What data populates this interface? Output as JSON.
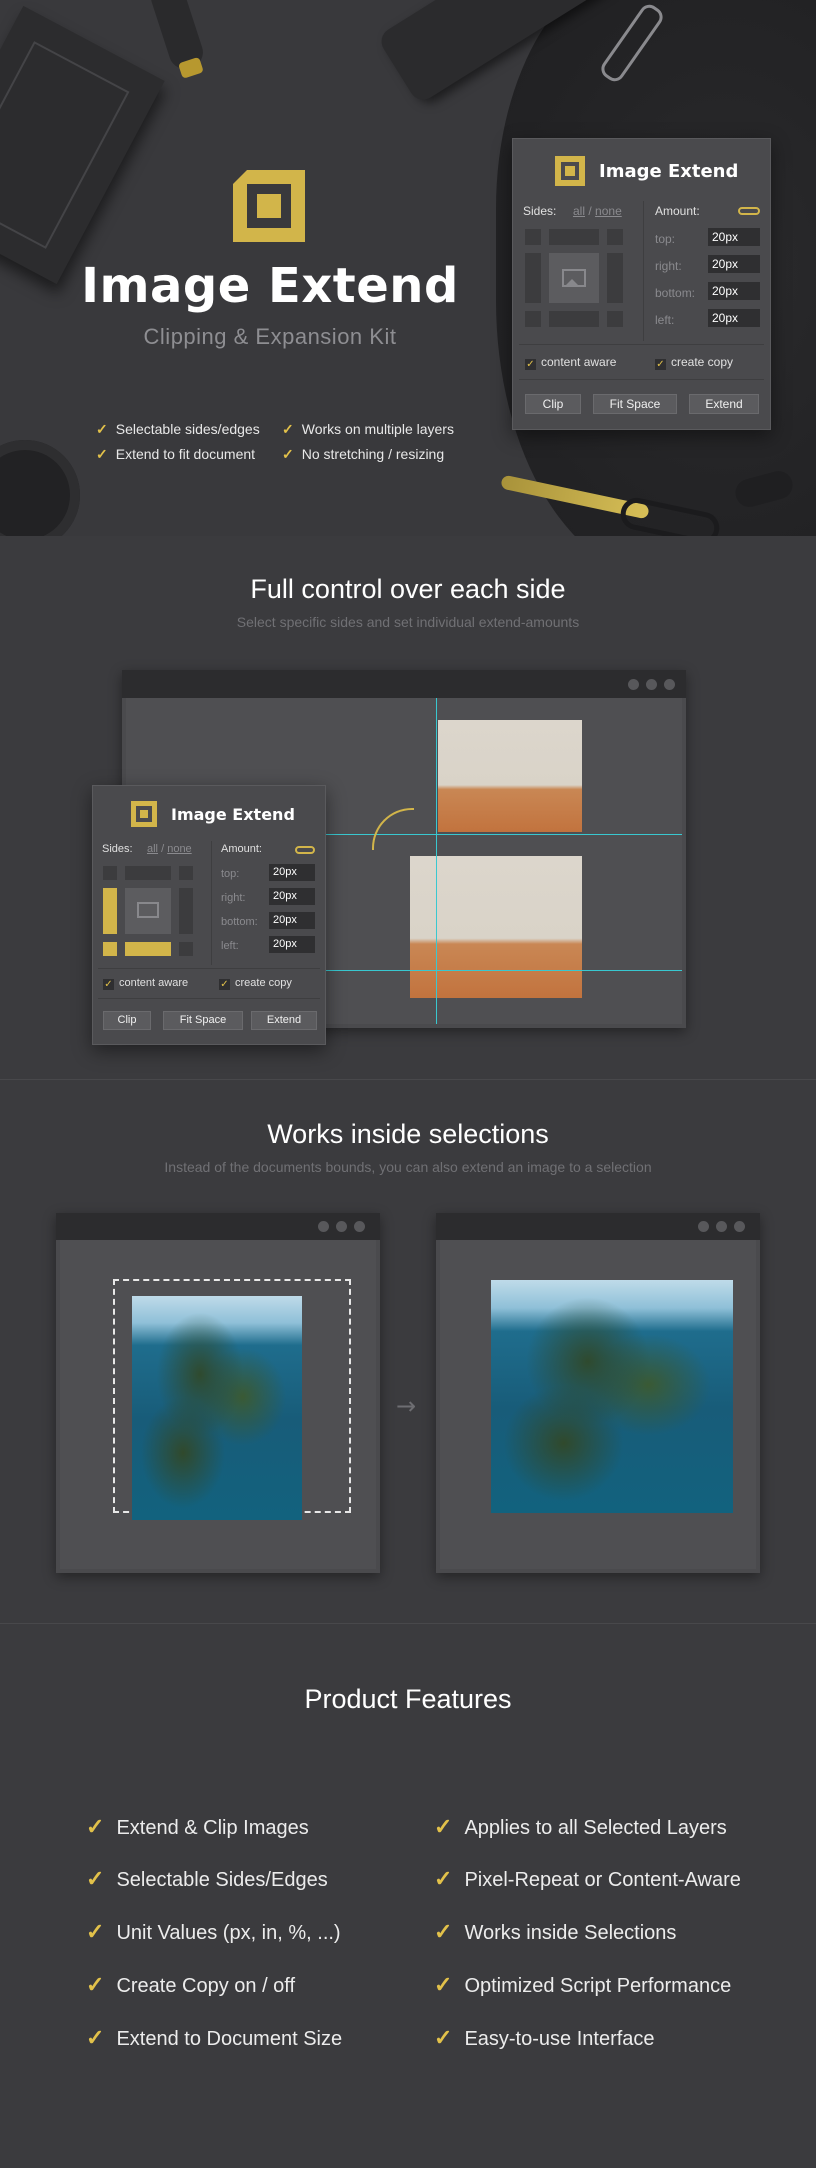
{
  "hero": {
    "title": "Image Extend",
    "subtitle": "Clipping & Expansion Kit",
    "features": [
      "Selectable sides/edges",
      "Works on multiple layers",
      "Extend to fit document",
      "No stretching / resizing"
    ]
  },
  "panel": {
    "title": "Image Extend",
    "sides_label": "Sides:",
    "all_label": "all",
    "sep": "/",
    "none_label": "none",
    "amount_label": "Amount:",
    "fields": [
      {
        "label": "top:",
        "value": "20px"
      },
      {
        "label": "right:",
        "value": "20px"
      },
      {
        "label": "bottom:",
        "value": "20px"
      },
      {
        "label": "left:",
        "value": "20px"
      }
    ],
    "checkbox_mark": "✓",
    "content_aware_label": "content aware",
    "create_copy_label": "create copy",
    "clip_label": "Clip",
    "fit_space_label": "Fit Space",
    "extend_label": "Extend"
  },
  "section1": {
    "title": "Full control over each side",
    "subtitle": "Select specific sides and set individual extend-amounts"
  },
  "section2": {
    "title": "Works inside selections",
    "subtitle": "Instead of the documents bounds, you can also extend an image to a selection",
    "arrow": "→"
  },
  "features": {
    "title": "Product Features",
    "check": "✓",
    "left": [
      "Extend & Clip Images",
      "Selectable Sides/Edges",
      "Unit Values (px, in, %, ...)",
      "Create Copy on / off",
      "Extend to Document Size"
    ],
    "right": [
      "Applies to all Selected Layers",
      "Pixel-Repeat or Content-Aware",
      "Works inside Selections",
      "Optimized Script Performance",
      "Easy-to-use Interface"
    ]
  },
  "colors": {
    "accent": "#d2b54a",
    "background": "#3b3b3e",
    "guide": "#39c8d0"
  }
}
